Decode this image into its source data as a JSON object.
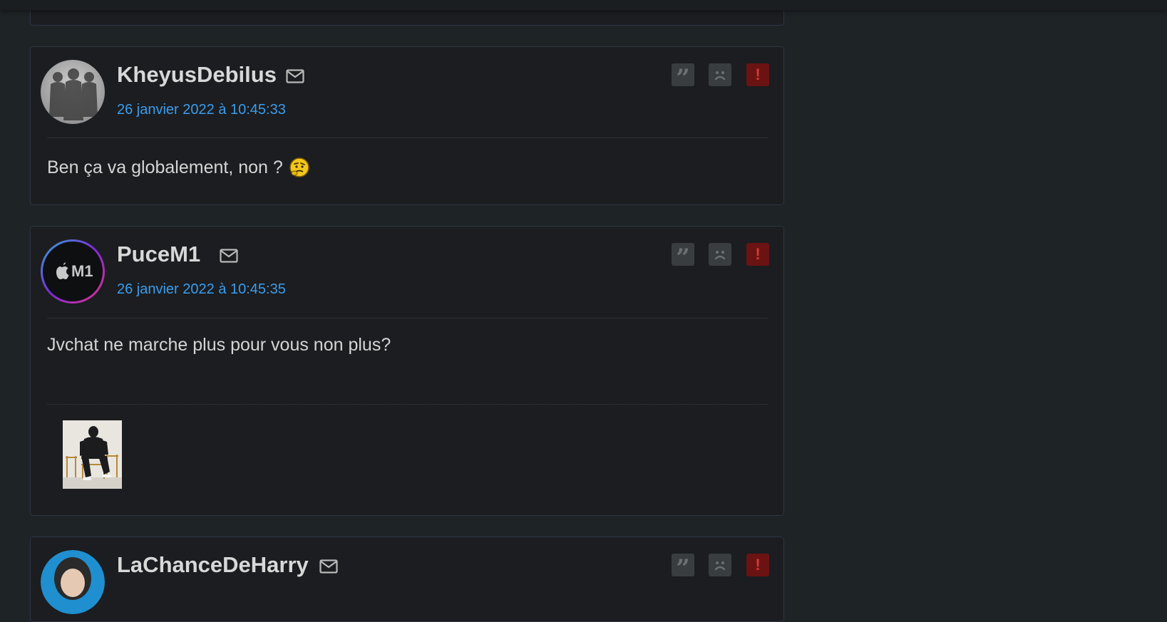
{
  "posts": [
    {
      "author": "KheyusDebilus",
      "date": "26 janvier 2022 à 10:45:33",
      "message": "Ben ça va globalement, non ?",
      "avatar": "silhouettes-avatar",
      "smiley": "thinking-smiley"
    },
    {
      "author": "PuceM1",
      "avatar_text": "M1",
      "date": "26 janvier 2022 à 10:45:35",
      "message": "Jvchat ne marche plus pour vous non plus?",
      "signature_image": "seated-person-thumbnail"
    },
    {
      "author": "LaChanceDeHarry",
      "avatar": "person-avatar"
    }
  ],
  "icons": {
    "mail": "mail-icon",
    "quote": "quote-icon",
    "sad": "sad-face-icon",
    "alert": "alert-icon"
  },
  "action_labels": {
    "quote_glyph": "”",
    "alert_glyph": "!"
  },
  "colors": {
    "background": "#1e2326",
    "card": "#1b1d20",
    "card_border": "#2d3642",
    "date_link": "#3b9ded",
    "alert_button": "#6b1313",
    "neutral_button": "#3a3d40"
  }
}
